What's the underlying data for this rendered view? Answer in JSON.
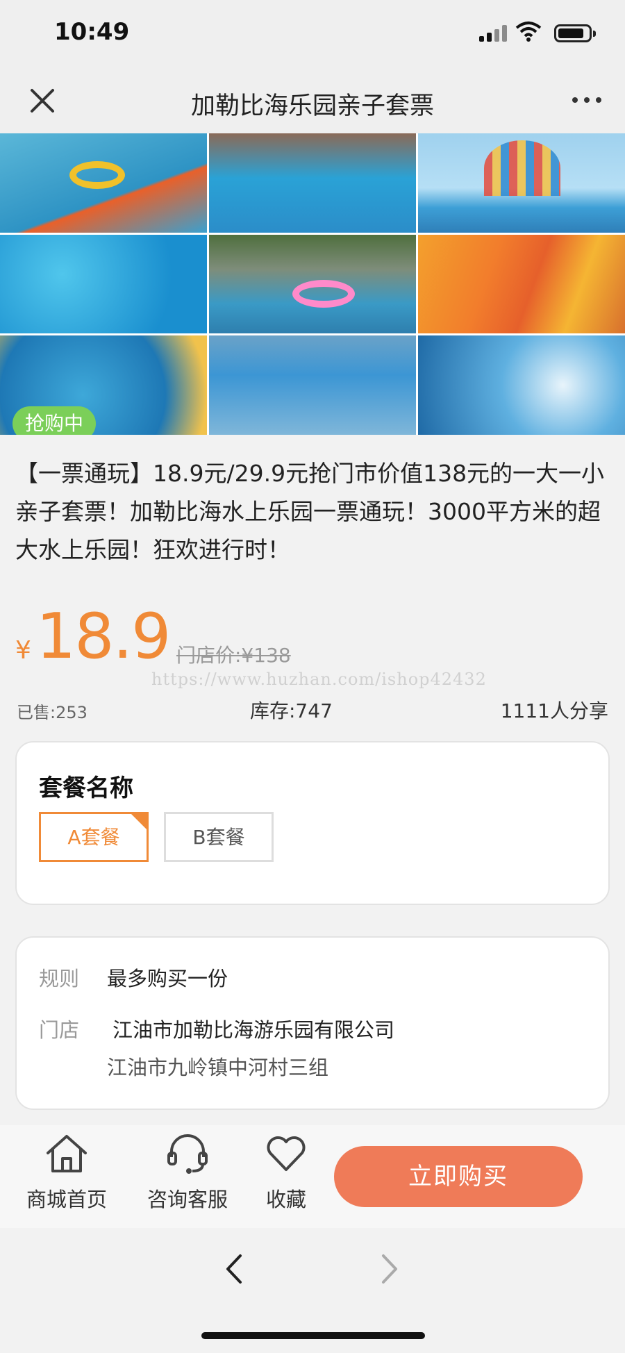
{
  "status_bar": {
    "time": "10:49"
  },
  "nav": {
    "title": "加勒比海乐园亲子套票"
  },
  "hero": {
    "badge": "抢购中"
  },
  "product": {
    "title": "【一票通玩】18.9元/29.9元抢门市价值138元的一大一小亲子套票！加勒比海水上乐园一票通玩！3000平方米的超大水上乐园！狂欢进行时！",
    "currency": "¥",
    "price": "18.9",
    "original_price": "门店价:¥138",
    "watermark": "https://www.huzhan.com/ishop42432",
    "sold": "已售:253",
    "stock": "库存:747",
    "shares": "1111人分享"
  },
  "package": {
    "heading": "套餐名称",
    "options": [
      "A套餐",
      "B套餐"
    ],
    "selected": "A套餐"
  },
  "info": {
    "rule_label": "规则",
    "rule_value": "最多购买一份",
    "store_label": "门店",
    "store_name": "江油市加勒比海游乐园有限公司",
    "store_address": "江油市九岭镇中河村三组"
  },
  "bottom_bar": {
    "home": "商城首页",
    "service": "咨询客服",
    "favorite": "收藏",
    "buy": "立即购买"
  },
  "colors": {
    "accent": "#f08a37",
    "buy_button": "#ef7b58",
    "badge": "#7bcf59"
  }
}
